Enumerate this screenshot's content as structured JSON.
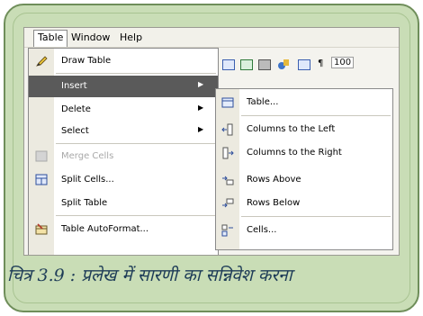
{
  "menubar": {
    "items": [
      {
        "label": "Table"
      },
      {
        "label": "Window"
      },
      {
        "label": "Help"
      }
    ]
  },
  "toolbar": {
    "zoom_text": "100",
    "pilcrow": "¶"
  },
  "table_menu": {
    "items": [
      {
        "label": "Draw Table",
        "icon": "pencil-icon"
      },
      {
        "label": "Insert",
        "icon": "",
        "submenu": true,
        "highlighted": true
      },
      {
        "label": "Delete",
        "icon": "",
        "submenu": true
      },
      {
        "label": "Select",
        "icon": "",
        "submenu": true
      },
      {
        "label": "Merge Cells",
        "icon": "merge-cells-icon",
        "disabled": true
      },
      {
        "label": "Split Cells...",
        "icon": "split-cells-icon"
      },
      {
        "label": "Split Table",
        "icon": ""
      },
      {
        "label": "Table AutoFormat...",
        "icon": "autoformat-icon"
      }
    ],
    "arrow": "▶"
  },
  "insert_submenu": {
    "items": [
      {
        "label": "Table...",
        "icon": "table-icon"
      },
      {
        "label": "Columns to the Left",
        "icon": "columns-left-icon"
      },
      {
        "label": "Columns to the Right",
        "icon": "columns-right-icon"
      },
      {
        "label": "Rows Above",
        "icon": "rows-above-icon"
      },
      {
        "label": "Rows Below",
        "icon": "rows-below-icon"
      },
      {
        "label": "Cells...",
        "icon": "cells-icon"
      }
    ]
  },
  "caption": "चित्र 3.9 : प्रलेख में सारणी का सन्निवेश करना",
  "colors": {
    "frame_bg": "#c9ddb6",
    "frame_border": "#6f8e5a",
    "highlight": "#5a5a5a",
    "caption": "#1d3b57"
  }
}
